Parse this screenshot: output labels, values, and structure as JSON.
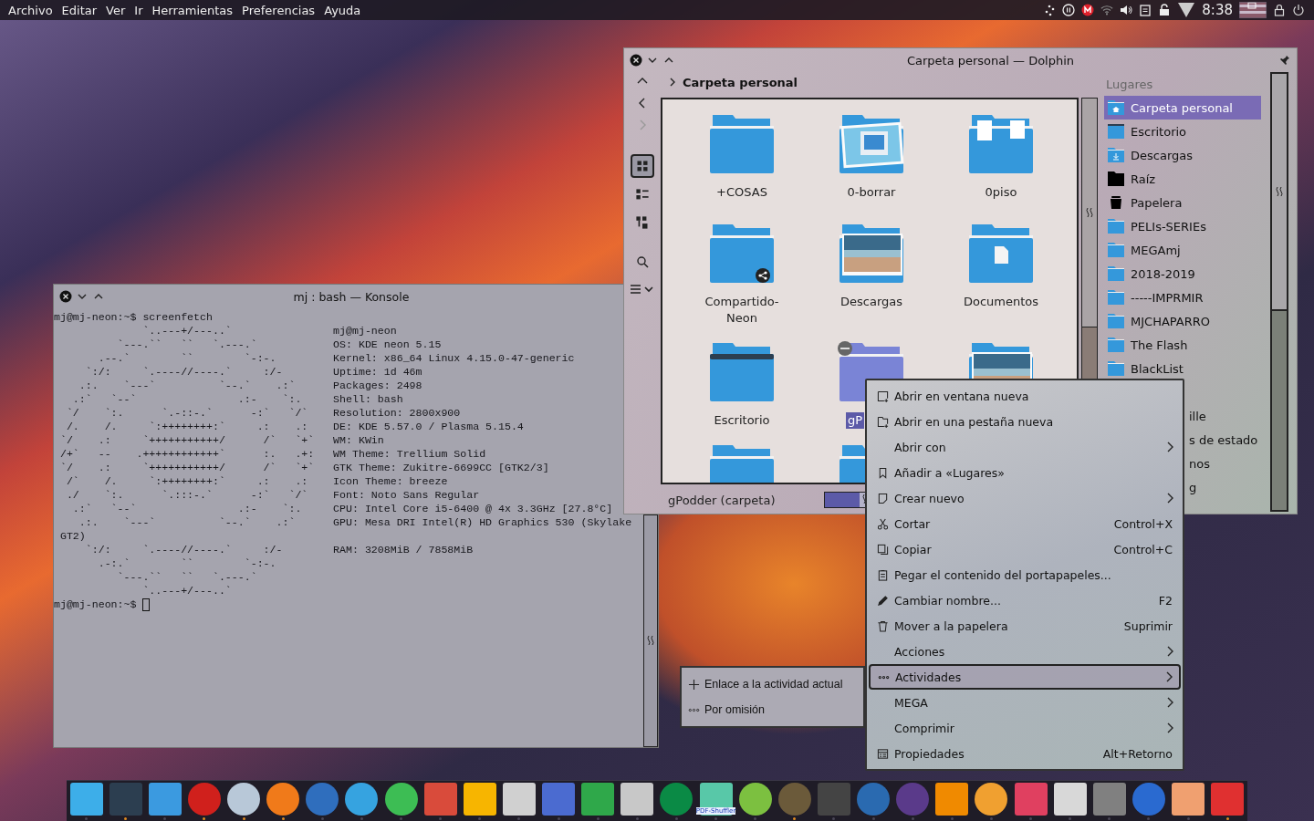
{
  "menubar": {
    "menus": [
      "Archivo",
      "Editar",
      "Ver",
      "Ir",
      "Herramientas",
      "Preferencias",
      "Ayuda"
    ],
    "clock": "8:38"
  },
  "konsole": {
    "title": "mj : bash — Konsole",
    "lines": [
      {
        "text": "mj@mj-neon:~$ screenfetch"
      },
      {
        "logo": "              `..---+/---..`",
        "info": "mj@mj-neon"
      },
      {
        "logo": "          `---.``   ``   `.---.`",
        "info": "OS: KDE neon 5.15"
      },
      {
        "logo": "       .--.`        ``        `-:-.",
        "info": "Kernel: x86_64 Linux 4.15.0-47-generic"
      },
      {
        "logo": "     `:/:     `.----//----.`     :/-",
        "info": "Uptime: 1d 46m"
      },
      {
        "logo": "    .:.    `---`          `--.`    .:`",
        "info": "Packages: 2498"
      },
      {
        "logo": "   .:`   `--`                .:-    `:.",
        "info": "Shell: bash"
      },
      {
        "logo": "  `/    `:.      `.-::-.`      -:`   `/`",
        "info": "Resolution: 2800x900"
      },
      {
        "logo": "  /.    /.     `:++++++++:`     .:    .:",
        "info": "DE: KDE 5.57.0 / Plasma 5.15.4"
      },
      {
        "logo": " `/    .:     `+++++++++++/      /`   `+`",
        "info": "WM: KWin"
      },
      {
        "logo": " /+`   --    .++++++++++++`      :.   .+:",
        "info": "WM Theme: Trellium Solid"
      },
      {
        "logo": " `/    .:     `+++++++++++/      /`   `+`",
        "info": "GTK Theme: Zukitre-6699CC [GTK2/3]"
      },
      {
        "logo": "  /`    /.     `:++++++++:`     .:    .:",
        "info": "Icon Theme: breeze"
      },
      {
        "logo": "  ./    `:.      `.:::-.`      -:`   `/`",
        "info": "Font: Noto Sans Regular"
      },
      {
        "logo": "   .:`   `--`                .:-    `:.",
        "info": "CPU: Intel Core i5-6400 @ 4x 3.3GHz [27.8°C]"
      },
      {
        "logo": "    .:.    `---`          `--.`    .:`",
        "info": "GPU: Mesa DRI Intel(R) HD Graphics 530 (Skylake"
      },
      {
        "text": "GT2)",
        "wrapped": true
      },
      {
        "logo": "     `:/:     `.----//----.`     :/-",
        "info": "RAM: 3208MiB / 7858MiB"
      },
      {
        "logo": "       .-:.`        ``        `-:-."
      },
      {
        "logo": "          `---.``   ``   `.---.`"
      },
      {
        "logo": "              `..---+/---..`"
      },
      {
        "text": "mj@mj-neon:~$ ",
        "cursor": true
      }
    ]
  },
  "dolphin": {
    "title": "Carpeta personal — Dolphin",
    "nav": [
      {
        "kind": "up",
        "disabled": false
      },
      {
        "kind": "back",
        "disabled": false
      },
      {
        "kind": "forward",
        "disabled": true
      }
    ],
    "view_modes": [
      {
        "kind": "icons",
        "selected": true
      },
      {
        "kind": "details",
        "selected": false
      },
      {
        "kind": "tree",
        "selected": false
      }
    ],
    "breadcrumb": "Carpeta personal",
    "items": [
      {
        "name": "+COSAS",
        "kind": "folder",
        "selected": false
      },
      {
        "name": "0-borrar",
        "kind": "screens",
        "selected": false
      },
      {
        "name": "0piso",
        "kind": "papers",
        "selected": false
      },
      {
        "name": "Compartido-Neon",
        "kind": "shared",
        "selected": false
      },
      {
        "name": "Descargas",
        "kind": "photo",
        "selected": false
      },
      {
        "name": "Documentos",
        "kind": "document",
        "selected": false
      },
      {
        "name": "Escritorio",
        "kind": "desktop",
        "selected": false
      },
      {
        "name": "gP",
        "kind": "folder",
        "selected": true
      },
      {
        "kind": "photo",
        "selected": false
      },
      {
        "kind": "folder",
        "selected": false
      },
      {
        "kind": "folder",
        "selected": false
      }
    ],
    "status": "gPodder (carpeta)",
    "zoom": {
      "level": 0.72
    },
    "places_title": "Lugares",
    "places": [
      {
        "name": "Carpeta personal",
        "kind": "home",
        "selected": true
      },
      {
        "name": "Escritorio",
        "kind": "desktop",
        "selected": false
      },
      {
        "name": "Descargas",
        "kind": "download",
        "selected": false
      },
      {
        "name": "Raíz",
        "kind": "root",
        "selected": false
      },
      {
        "name": "Papelera",
        "kind": "trash",
        "selected": false
      },
      {
        "name": "PELIs-SERIEs",
        "kind": "folder",
        "selected": false
      },
      {
        "name": "MEGAmj",
        "kind": "folder",
        "selected": false
      },
      {
        "name": "2018-2019",
        "kind": "folder",
        "selected": false
      },
      {
        "name": "-----IMPRMIR",
        "kind": "folder",
        "selected": false
      },
      {
        "name": "MJCHAPARRO",
        "kind": "folder",
        "selected": false
      },
      {
        "name": "The Flash",
        "kind": "folder",
        "selected": false
      },
      {
        "name": "BlackList",
        "kind": "folder",
        "selected": false
      },
      {
        "kind": "covered",
        "selected": false
      },
      {
        "name": "ille",
        "kind": "covered",
        "selected": false
      },
      {
        "name": "s de estado",
        "kind": "covered",
        "selected": false
      },
      {
        "name": "nos",
        "kind": "covered",
        "selected": false
      },
      {
        "name": "g",
        "kind": "covered",
        "selected": false
      }
    ]
  },
  "context_menu": {
    "items": [
      {
        "label": "Abrir en ventana nueva",
        "submenu": false,
        "selected": false
      },
      {
        "label": "Abrir en una pestaña nueva",
        "submenu": false,
        "selected": false
      },
      {
        "label": "Abrir con",
        "submenu": true,
        "selected": false
      },
      {
        "label": "Añadir a «Lugares»",
        "submenu": false,
        "selected": false
      },
      {
        "label": "Crear nuevo",
        "submenu": true,
        "selected": false
      },
      {
        "label": "Cortar",
        "shortcut": "Control+X",
        "submenu": false,
        "selected": false
      },
      {
        "label": "Copiar",
        "shortcut": "Control+C",
        "submenu": false,
        "selected": false
      },
      {
        "label": "Pegar el contenido del portapapeles...",
        "submenu": false,
        "selected": false
      },
      {
        "label": "Cambiar nombre...",
        "shortcut": "F2",
        "submenu": false,
        "selected": false
      },
      {
        "label": "Mover a la papelera",
        "shortcut": "Suprimir",
        "submenu": false,
        "selected": false
      },
      {
        "label": "Acciones",
        "submenu": true,
        "selected": false
      },
      {
        "label": "Actividades",
        "submenu": true,
        "selected": true
      },
      {
        "label": "MEGA",
        "submenu": true,
        "selected": false
      },
      {
        "label": "Comprimir",
        "submenu": true,
        "selected": false
      },
      {
        "label": "Propiedades",
        "shortcut": "Alt+Retorno",
        "submenu": false,
        "selected": false
      }
    ]
  },
  "submenu": {
    "items": [
      {
        "label": "Enlace a la actividad actual"
      },
      {
        "label": "Por omisión"
      }
    ]
  },
  "dock": {
    "items": [
      {
        "running": false
      },
      {
        "running": true
      },
      {
        "running": false
      },
      {
        "running": true
      },
      {
        "running": true
      },
      {
        "running": true
      },
      {
        "running": false
      },
      {
        "running": false
      },
      {
        "running": false
      },
      {
        "running": false
      },
      {
        "running": false
      },
      {
        "running": false
      },
      {
        "running": false
      },
      {
        "running": false
      },
      {
        "running": false
      },
      {
        "running": false
      },
      {
        "running": false,
        "caption": "PDF-Shuffler"
      },
      {
        "running": false
      },
      {
        "running": true
      },
      {
        "running": false
      },
      {
        "running": false
      },
      {
        "running": false
      },
      {
        "running": false
      },
      {
        "running": false
      },
      {
        "running": false
      },
      {
        "running": false
      },
      {
        "running": false
      },
      {
        "running": false
      },
      {
        "running": false
      },
      {
        "running": true
      }
    ]
  }
}
